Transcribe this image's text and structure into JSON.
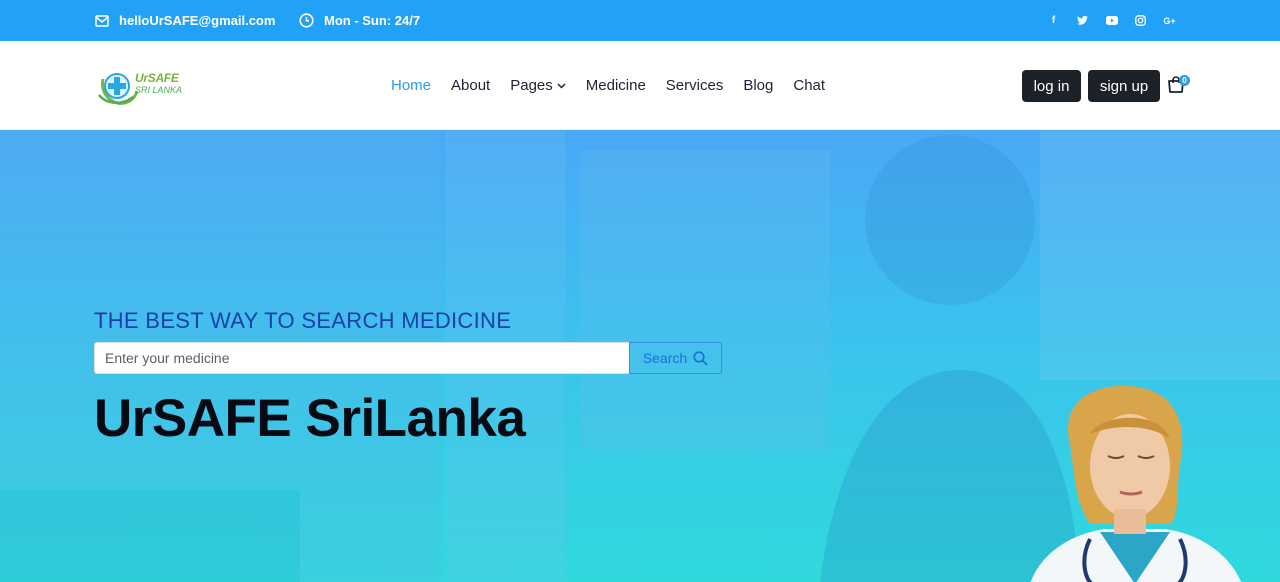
{
  "topbar": {
    "email": "helloUrSAFE@gmail.com",
    "hours": "Mon - Sun: 24/7",
    "socials": [
      "facebook-icon",
      "twitter-icon",
      "youtube-icon",
      "instagram-icon",
      "google-plus-icon"
    ]
  },
  "header": {
    "logo": {
      "line1": "UrSAFE",
      "line2": "SRI LANKA"
    },
    "nav": [
      "Home",
      "About",
      "Pages",
      "Medicine",
      "Services",
      "Blog",
      "Chat"
    ],
    "login_label": "log in",
    "signup_label": "sign up",
    "cart_count": "0"
  },
  "hero": {
    "tagline": "THE BEST WAY TO SEARCH MEDICINE",
    "search_placeholder": "Enter your medicine",
    "search_label": "Search",
    "title": "UrSAFE SriLanka"
  },
  "colors": {
    "topbar": "#22a2f7",
    "accent": "#2f9ceb",
    "tagline": "#1a3fad",
    "button_dark": "#1c2227"
  }
}
